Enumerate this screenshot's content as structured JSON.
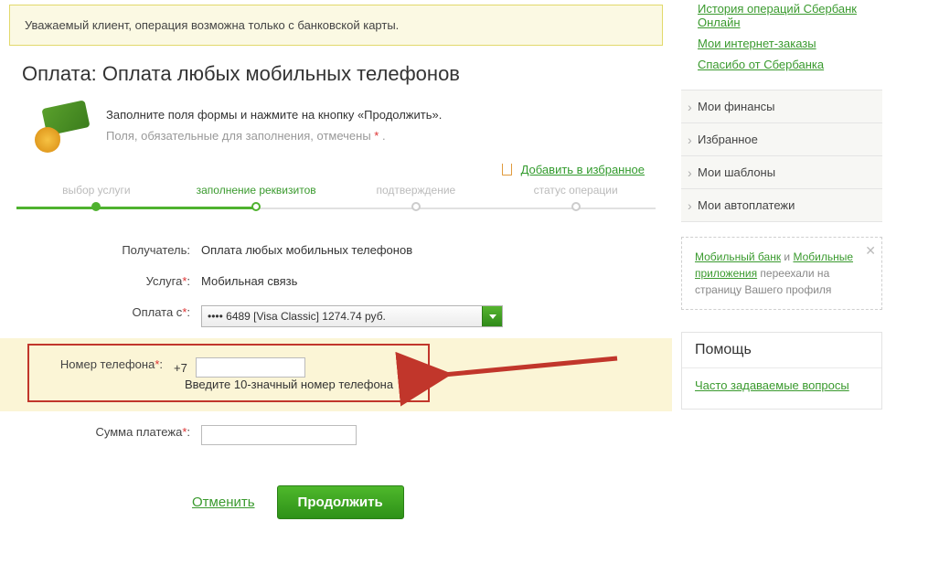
{
  "alert": {
    "text": "Уважаемый клиент, операция возможна только с банковской карты."
  },
  "page_title": "Оплата: Оплата любых мобильных телефонов",
  "instructions": {
    "line1": "Заполните поля формы и нажмите на кнопку «Продолжить».",
    "line2_prefix": "Поля, обязательные для заполнения, отмечены ",
    "line2_mark": "*",
    "line2_suffix": " ."
  },
  "favorites_link": "Добавить в избранное",
  "steps": {
    "items": [
      {
        "label": "выбор услуги",
        "state": "done"
      },
      {
        "label": "заполнение реквизитов",
        "state": "active"
      },
      {
        "label": "подтверждение",
        "state": "future"
      },
      {
        "label": "статус операции",
        "state": "future"
      }
    ]
  },
  "form": {
    "recipient": {
      "label": "Получатель:",
      "value": "Оплата любых мобильных телефонов"
    },
    "service": {
      "label": "Услуга",
      "mark": "*",
      "colon": ":",
      "value": "Мобильная связь"
    },
    "pay_from": {
      "label": "Оплата с",
      "mark": "*",
      "colon": ":",
      "value": "•••• 6489 [Visa Classic] 1274.74 руб."
    },
    "phone": {
      "label": "Номер телефона",
      "mark": "*",
      "colon": ":",
      "prefix": "+7",
      "value": "",
      "hint": "Введите 10-значный номер телефона"
    },
    "amount": {
      "label": "Сумма платежа",
      "mark": "*",
      "colon": ":",
      "value": ""
    }
  },
  "actions": {
    "cancel": "Отменить",
    "continue": "Продолжить"
  },
  "sidebar": {
    "links": [
      "История операций Сбербанк Онлайн",
      "Мои интернет-заказы",
      "Спасибо от Сбербанка"
    ],
    "menu": [
      "Мои финансы",
      "Избранное",
      "Мои шаблоны",
      "Мои автоплатежи"
    ],
    "notice": {
      "link1": "Мобильный банк",
      "conj": " и ",
      "link2": "Мобильные приложения",
      "tail": " переехали на страницу Вашего профиля"
    },
    "help": {
      "title": "Помощь",
      "faq": "Часто задаваемые вопросы"
    }
  }
}
